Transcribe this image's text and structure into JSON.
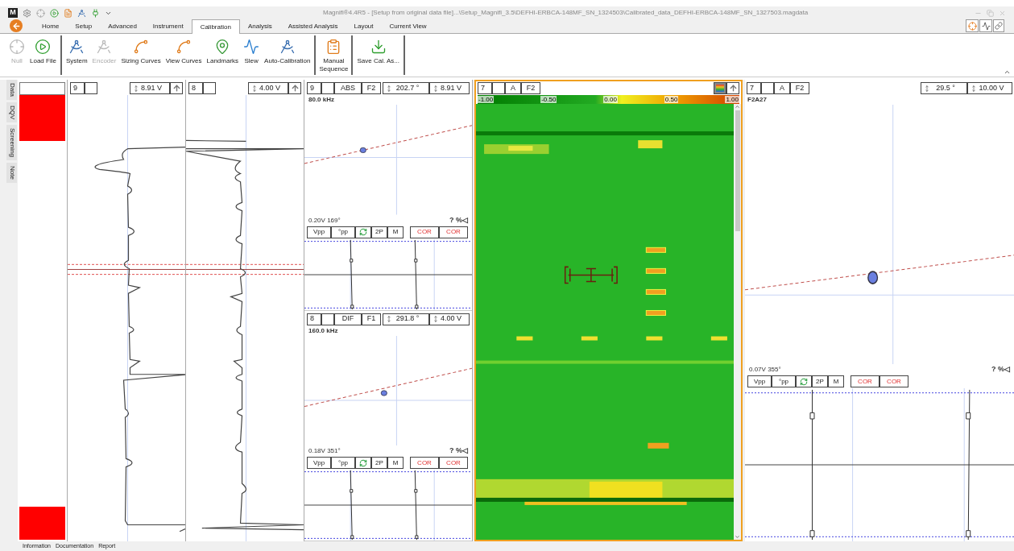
{
  "title": "Magnifi®4.4R5 - [Setup from original data file]...\\Setup_Magnifi_3.5\\DEFHI-ERBCA-148MF_SN_1324503\\Calibrated_data_DEFHI-ERBCA-148MF_SN_1327503.magdata",
  "app_logo": "M",
  "menu_tabs": [
    {
      "label": "Home",
      "selected": false
    },
    {
      "label": "Setup",
      "selected": false
    },
    {
      "label": "Advanced",
      "selected": false
    },
    {
      "label": "Instrument",
      "selected": false
    },
    {
      "label": "Calibration",
      "selected": true
    },
    {
      "label": "Analysis",
      "selected": false
    },
    {
      "label": "Assisted Analysis",
      "selected": false
    },
    {
      "label": "Layout",
      "selected": false
    },
    {
      "label": "Current View",
      "selected": false
    }
  ],
  "ribbon_groups": [
    [
      {
        "label": "Null",
        "disabled": true
      },
      {
        "label": "Load File",
        "disabled": false
      }
    ],
    [
      {
        "label": "System",
        "disabled": false
      },
      {
        "label": "Encoder",
        "disabled": true
      },
      {
        "label": "Sizing Curves",
        "disabled": false
      },
      {
        "label": "View Curves",
        "disabled": false
      },
      {
        "label": "Landmarks",
        "disabled": false
      },
      {
        "label": "Slew",
        "disabled": false
      },
      {
        "label": "Auto-Calibration",
        "disabled": false
      }
    ],
    [
      {
        "label": "Manual Sequence",
        "disabled": false
      }
    ],
    [
      {
        "label": "Save Cal. As...",
        "disabled": false
      }
    ]
  ],
  "side_tabs": [
    "Data",
    "DQV",
    "Screening",
    "Note"
  ],
  "strip_charts": [
    {
      "channel": "9",
      "scale": "8.91 V"
    },
    {
      "channel": "8",
      "scale": "4.00 V"
    }
  ],
  "lissajous": [
    {
      "channel": "9",
      "mode": "ABS",
      "frequency_channel": "F2",
      "rotation": "202.7 °",
      "scale": "8.91 V",
      "frequency": "80.0 kHz",
      "reading": "0.20V 169°",
      "help": "? %◁",
      "buttons": [
        {
          "kind": "dropdown",
          "label": "Vpp"
        },
        {
          "kind": "dropdown",
          "label": "°pp"
        },
        {
          "kind": "refresh"
        },
        {
          "kind": "plain",
          "label": "2P"
        },
        {
          "kind": "plain",
          "label": "M"
        },
        {
          "kind": "warning",
          "label": "COR"
        },
        {
          "kind": "warning",
          "label": "COR"
        }
      ]
    },
    {
      "channel": "8",
      "mode": "DIF",
      "frequency_channel": "F1",
      "rotation": "291.8 °",
      "scale": "4.00 V",
      "frequency": "160.0 kHz",
      "reading": "0.18V 351°",
      "help": "? %◁",
      "buttons": [
        {
          "kind": "dropdown",
          "label": "Vpp"
        },
        {
          "kind": "dropdown",
          "label": "°pp"
        },
        {
          "kind": "refresh"
        },
        {
          "kind": "plain",
          "label": "2P"
        },
        {
          "kind": "plain",
          "label": "M"
        },
        {
          "kind": "warning",
          "label": "COR"
        },
        {
          "kind": "warning",
          "label": "COR"
        }
      ]
    }
  ],
  "cscan": {
    "channel": "7",
    "mode": "A",
    "frequency_channel": "F2",
    "ticks": [
      "-1.00",
      "-0.50",
      "0.00",
      "0.50",
      "1.00"
    ]
  },
  "right_panel": {
    "channel": "7",
    "mode": "A",
    "frequency_channel": "F2",
    "rotation": "29.5 °",
    "scale": "10.00 V",
    "label": "F2A27",
    "reading": "0.07V 355°",
    "help": "? %◁",
    "buttons": [
      {
        "kind": "dropdown",
        "label": "Vpp"
      },
      {
        "kind": "dropdown",
        "label": "°pp"
      },
      {
        "kind": "refresh"
      },
      {
        "kind": "plain",
        "label": "2P"
      },
      {
        "kind": "plain",
        "label": "M"
      },
      {
        "kind": "warning",
        "label": "COR"
      },
      {
        "kind": "warning",
        "label": "COR"
      }
    ]
  },
  "bottom_tabs": [
    "Information",
    "Documentation",
    "Report"
  ]
}
